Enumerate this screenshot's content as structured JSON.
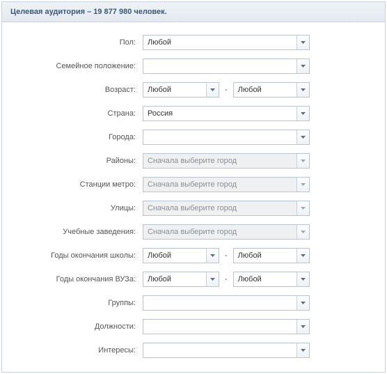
{
  "header": {
    "title": "Целевая аудитория – 19 877 980 человек."
  },
  "common": {
    "any": "Любой",
    "dash": "-",
    "city_first": "Сначала выберите город"
  },
  "fields": {
    "gender": {
      "label": "Пол:"
    },
    "marital": {
      "label": "Семейное положение:"
    },
    "age": {
      "label": "Возраст:"
    },
    "country": {
      "label": "Страна:",
      "value": "Россия"
    },
    "cities": {
      "label": "Города:"
    },
    "districts": {
      "label": "Районы:"
    },
    "metro": {
      "label": "Станции метро:"
    },
    "streets": {
      "label": "Улицы:"
    },
    "schools": {
      "label": "Учебные заведения:"
    },
    "school_years": {
      "label": "Годы окончания школы:"
    },
    "uni_years": {
      "label": "Годы окончания ВУЗа:"
    },
    "groups": {
      "label": "Группы:"
    },
    "positions": {
      "label": "Должности:"
    },
    "interests": {
      "label": "Интересы:"
    }
  }
}
